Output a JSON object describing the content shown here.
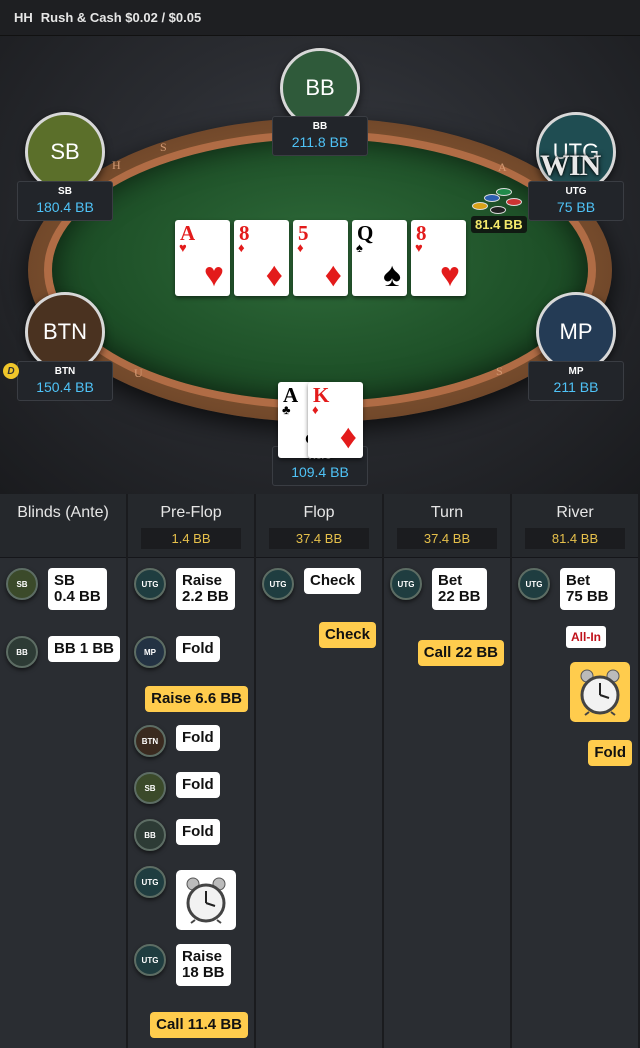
{
  "header": {
    "title": "HH",
    "game": "Rush & Cash $0.02 / $0.05"
  },
  "rail_letters": [
    "H",
    "S",
    "A",
    "U",
    "S"
  ],
  "seats": {
    "bb": {
      "label": "BB",
      "name": "BB",
      "stack": "211.8 BB",
      "color": "#2f5a3a"
    },
    "sb": {
      "label": "SB",
      "name": "SB",
      "stack": "180.4 BB",
      "color": "#5b6f2a"
    },
    "utg": {
      "label": "UTG",
      "name": "UTG",
      "stack": "75 BB",
      "color": "#1f4d52"
    },
    "btn": {
      "label": "BTN",
      "name": "BTN",
      "stack": "150.4 BB",
      "color": "#4a3220"
    },
    "mp": {
      "label": "MP",
      "name": "MP",
      "stack": "211 BB",
      "color": "#243b55"
    },
    "hero": {
      "name": "Hero",
      "stack": "109.4 BB"
    }
  },
  "win_label": "WIN",
  "dealer_button": "D",
  "pot": "81.4 BB",
  "board": [
    {
      "rank": "A",
      "suit": "♥",
      "color": "red"
    },
    {
      "rank": "8",
      "suit": "♦",
      "color": "red"
    },
    {
      "rank": "5",
      "suit": "♦",
      "color": "red"
    },
    {
      "rank": "Q",
      "suit": "♠",
      "color": "black"
    },
    {
      "rank": "8",
      "suit": "♥",
      "color": "red"
    }
  ],
  "hero_cards": [
    {
      "rank": "A",
      "suit": "♣",
      "color": "black"
    },
    {
      "rank": "K",
      "suit": "♦",
      "color": "red"
    }
  ],
  "streets": [
    {
      "title": "Blinds (Ante)",
      "pot": ""
    },
    {
      "title": "Pre-Flop",
      "pot": "1.4 BB"
    },
    {
      "title": "Flop",
      "pot": "37.4 BB"
    },
    {
      "title": "Turn",
      "pot": "37.4 BB"
    },
    {
      "title": "River",
      "pot": "81.4 BB"
    }
  ],
  "actions": {
    "blinds": [
      {
        "player": "SB",
        "line1": "SB",
        "line2": "0.4 BB"
      },
      {
        "player": "BB",
        "line1": "BB 1 BB"
      }
    ],
    "preflop": [
      {
        "player": "UTG",
        "line1": "Raise",
        "line2": "2.2 BB"
      },
      {
        "player": "MP",
        "line1": "Fold"
      },
      {
        "hero": true,
        "line1": "Raise 6.6 BB"
      },
      {
        "player": "BTN",
        "line1": "Fold"
      },
      {
        "player": "SB",
        "line1": "Fold"
      },
      {
        "player": "BB",
        "line1": "Fold"
      },
      {
        "player": "UTG",
        "timer": true
      },
      {
        "player": "UTG",
        "line1": "Raise",
        "line2": "18 BB"
      },
      {
        "hero": true,
        "line1": "Call 11.4 BB"
      }
    ],
    "flop": [
      {
        "player": "UTG",
        "line1": "Check"
      },
      {
        "hero": true,
        "line1": "Check"
      }
    ],
    "turn": [
      {
        "player": "UTG",
        "line1": "Bet",
        "line2": "22 BB"
      },
      {
        "hero": true,
        "line1": "Call 22 BB"
      }
    ],
    "river": [
      {
        "player": "UTG",
        "line1": "Bet",
        "line2": "75 BB"
      },
      {
        "badge": "All-In"
      },
      {
        "hero": true,
        "timer": true
      },
      {
        "hero": true,
        "line1": "Fold"
      }
    ]
  },
  "colors": {
    "accent": "#ffcc4d",
    "stack": "#4fc3f7",
    "pot": "#e6c04b"
  }
}
